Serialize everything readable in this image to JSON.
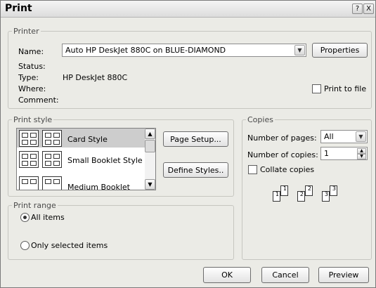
{
  "window": {
    "title": "Print",
    "help": "?",
    "close": "X"
  },
  "printer": {
    "legend": "Printer",
    "name_label": "Name:",
    "name_value": "Auto HP DeskJet 880C on BLUE-DIAMOND",
    "properties_label": "Properties",
    "status_label": "Status:",
    "status_value": "",
    "type_label": "Type:",
    "type_value": "HP DeskJet 880C",
    "where_label": "Where:",
    "where_value": "",
    "comment_label": "Comment:",
    "comment_value": "",
    "print_to_file_label": "Print to file",
    "print_to_file_checked": false
  },
  "print_style": {
    "legend": "Print style",
    "items": [
      {
        "label": "Card Style",
        "selected": true
      },
      {
        "label": "Small Booklet Style",
        "selected": false
      },
      {
        "label": "Medium Booklet",
        "selected": false
      }
    ],
    "page_setup_label": "Page Setup...",
    "define_styles_label": "Define Styles.."
  },
  "copies": {
    "legend": "Copies",
    "pages_label": "Number of pages:",
    "pages_value": "All",
    "copies_label": "Number of copies:",
    "copies_value": "1",
    "collate_label": "Collate copies",
    "collate_checked": false,
    "collate_sets": [
      [
        "1",
        "1"
      ],
      [
        "2",
        "2"
      ],
      [
        "3",
        "3"
      ]
    ]
  },
  "print_range": {
    "legend": "Print range",
    "all_items_label": "All items",
    "all_items_selected": true,
    "only_selected_label": "Only selected items",
    "only_selected_selected": false
  },
  "footer": {
    "ok_label": "OK",
    "cancel_label": "Cancel",
    "preview_label": "Preview"
  }
}
